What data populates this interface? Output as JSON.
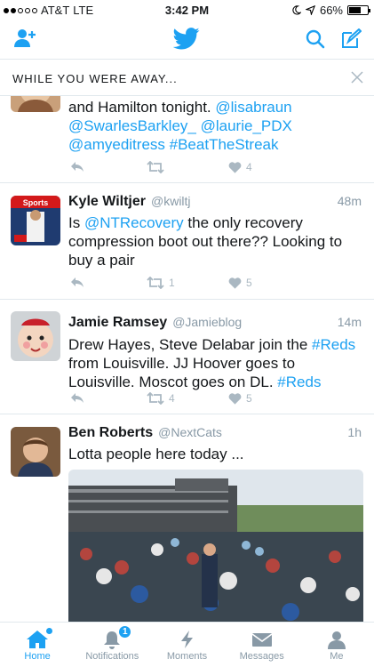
{
  "status_bar": {
    "carrier": "AT&T",
    "network": "LTE",
    "time": "3:42 PM",
    "battery": "66%",
    "battery_level": 0.66
  },
  "nav": {
    "add_user_icon": "add-user-icon",
    "logo_icon": "twitter-bird-icon",
    "search_icon": "search-icon",
    "compose_icon": "compose-icon"
  },
  "away_bar": {
    "title": "WHILE YOU WERE AWAY...",
    "close_icon": "close-icon"
  },
  "tweets": [
    {
      "text_parts": [
        {
          "t": "and Hamilton tonight.  "
        },
        {
          "t": "@lisabraun",
          "link": true
        },
        {
          "t": " "
        },
        {
          "t": "@SwarlesBarkley_",
          "link": true
        },
        {
          "t": " "
        },
        {
          "t": "@laurie_PDX",
          "link": true
        },
        {
          "t": " "
        },
        {
          "t": "@amyeditress",
          "link": true
        },
        {
          "t": " "
        },
        {
          "t": "#BeatTheStreak",
          "link": true
        }
      ],
      "retweets": "",
      "likes": "4"
    },
    {
      "name": "Kyle Wiltjer",
      "handle": "@kwiltj",
      "time": "48m",
      "text_parts": [
        {
          "t": "Is "
        },
        {
          "t": "@NTRecovery",
          "link": true
        },
        {
          "t": " the only recovery compression boot out there?? Looking to buy a pair"
        }
      ],
      "retweets": "1",
      "likes": "5",
      "avatar_label": "Sports Illustrated"
    },
    {
      "name": "Jamie Ramsey",
      "handle": "@Jamieblog",
      "time": "14m",
      "text_parts": [
        {
          "t": "Drew Hayes, Steve Delabar join the "
        },
        {
          "t": "#Reds",
          "link": true
        },
        {
          "t": " from Louisville.  JJ Hoover goes to Louisville.  Moscot goes on DL. "
        },
        {
          "t": "#Reds",
          "link": true
        }
      ],
      "retweets": "4",
      "likes": "5"
    },
    {
      "name": "Ben Roberts",
      "handle": "@NextCats",
      "time": "1h",
      "text_parts": [
        {
          "t": "Lotta people here today ..."
        }
      ]
    }
  ],
  "tabs": [
    {
      "label": "Home",
      "icon": "home-icon"
    },
    {
      "label": "Notifications",
      "icon": "bell-icon",
      "badge": "1"
    },
    {
      "label": "Moments",
      "icon": "lightning-icon"
    },
    {
      "label": "Messages",
      "icon": "envelope-icon"
    },
    {
      "label": "Me",
      "icon": "person-icon"
    }
  ],
  "colors": {
    "accent": "#1da1f2",
    "muted": "#8899a6",
    "divider": "#e1e8ed"
  }
}
